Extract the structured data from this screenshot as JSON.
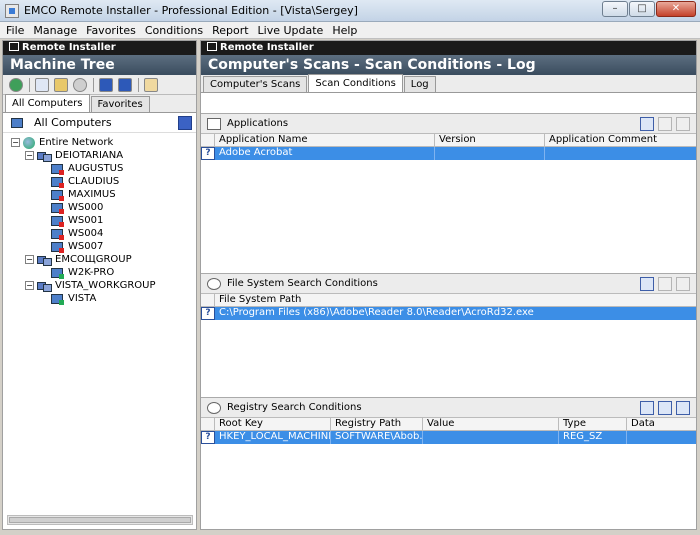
{
  "window": {
    "title": "EMCO Remote Installer - Professional Edition - [Vista\\Sergey]",
    "min_glyph": "–",
    "max_glyph": "□",
    "close_glyph": "✕"
  },
  "menu": [
    "File",
    "Manage",
    "Favorites",
    "Conditions",
    "Report",
    "Live Update",
    "Help"
  ],
  "left_pane": {
    "banner": "Remote Installer",
    "title": "Machine Tree",
    "tabs": [
      "All Computers",
      "Favorites"
    ],
    "active_tab": "All Computers",
    "all_computers_label": "All Computers",
    "tree": {
      "root": "Entire Network",
      "groups": [
        {
          "name": "DEIOTARIANA",
          "machines": [
            "AUGUSTUS",
            "CLAUDIUS",
            "MAXIMUS",
            "WS000",
            "WS001",
            "WS004",
            "WS007"
          ]
        },
        {
          "name": "EMCOЩGROUP",
          "machines": [
            "W2K-PRO"
          ]
        },
        {
          "name": "VISTA_WORKGROUP",
          "machines": [
            "VISTA"
          ]
        }
      ]
    }
  },
  "right_pane": {
    "banner": "Remote Installer",
    "title": "Computer's Scans - Scan Conditions - Log",
    "tabs": [
      "Computer's Scans",
      "Scan Conditions",
      "Log"
    ],
    "active_tab": "Scan Conditions",
    "applications": {
      "title": "Applications",
      "columns": [
        "Application Name",
        "Version",
        "Application Comment"
      ],
      "rows": [
        [
          "Adobe Acrobat",
          "",
          ""
        ]
      ]
    },
    "file_system": {
      "title": "File System Search Conditions",
      "columns": [
        "File System Path"
      ],
      "rows": [
        [
          "C:\\Program Files (x86)\\Adobe\\Reader 8.0\\Reader\\AcroRd32.exe"
        ]
      ]
    },
    "registry": {
      "title": "Registry Search Conditions",
      "columns": [
        "Root Key",
        "Registry Path",
        "Value",
        "Type",
        "Data"
      ],
      "rows": [
        [
          "HKEY_LOCAL_MACHINE",
          "SOFTWARE\\Abob...",
          "",
          "REG_SZ",
          ""
        ]
      ]
    }
  },
  "colors": {
    "selection": "#3c8ee6",
    "header_gradient_top": "#5c6e80",
    "banner_bg": "#1a1a1a"
  }
}
